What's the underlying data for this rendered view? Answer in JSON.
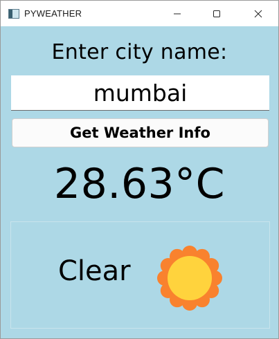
{
  "window": {
    "title": "PYWEATHER",
    "icon": "app-window-icon",
    "controls": [
      "minimize-icon",
      "maximize-icon",
      "close-icon"
    ]
  },
  "form": {
    "prompt": "Enter city name:",
    "city_value": "mumbai",
    "button_label": "Get Weather Info"
  },
  "weather": {
    "temperature": "28.63°C",
    "condition": "Clear",
    "condition_icon": "sun-icon"
  },
  "colors": {
    "background": "#add8e6",
    "sun_outer": "#f9822e",
    "sun_inner": "#ffd33d"
  }
}
